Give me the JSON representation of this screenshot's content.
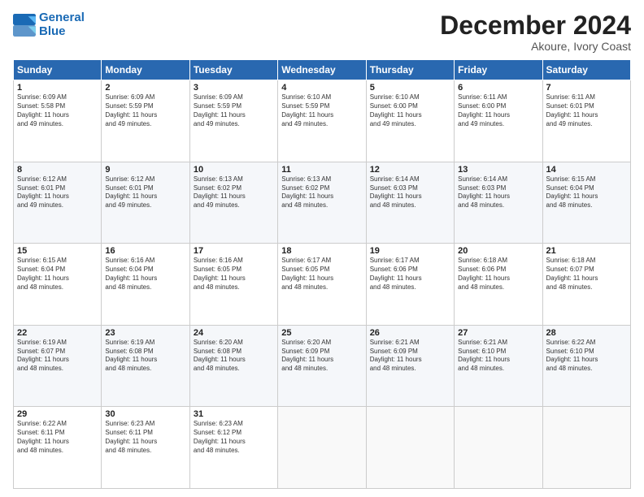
{
  "logo": {
    "line1": "General",
    "line2": "Blue"
  },
  "title": "December 2024",
  "location": "Akoure, Ivory Coast",
  "days_header": [
    "Sunday",
    "Monday",
    "Tuesday",
    "Wednesday",
    "Thursday",
    "Friday",
    "Saturday"
  ],
  "weeks": [
    [
      {
        "day": "1",
        "text": "Sunrise: 6:09 AM\nSunset: 5:58 PM\nDaylight: 11 hours\nand 49 minutes."
      },
      {
        "day": "2",
        "text": "Sunrise: 6:09 AM\nSunset: 5:59 PM\nDaylight: 11 hours\nand 49 minutes."
      },
      {
        "day": "3",
        "text": "Sunrise: 6:09 AM\nSunset: 5:59 PM\nDaylight: 11 hours\nand 49 minutes."
      },
      {
        "day": "4",
        "text": "Sunrise: 6:10 AM\nSunset: 5:59 PM\nDaylight: 11 hours\nand 49 minutes."
      },
      {
        "day": "5",
        "text": "Sunrise: 6:10 AM\nSunset: 6:00 PM\nDaylight: 11 hours\nand 49 minutes."
      },
      {
        "day": "6",
        "text": "Sunrise: 6:11 AM\nSunset: 6:00 PM\nDaylight: 11 hours\nand 49 minutes."
      },
      {
        "day": "7",
        "text": "Sunrise: 6:11 AM\nSunset: 6:01 PM\nDaylight: 11 hours\nand 49 minutes."
      }
    ],
    [
      {
        "day": "8",
        "text": "Sunrise: 6:12 AM\nSunset: 6:01 PM\nDaylight: 11 hours\nand 49 minutes."
      },
      {
        "day": "9",
        "text": "Sunrise: 6:12 AM\nSunset: 6:01 PM\nDaylight: 11 hours\nand 49 minutes."
      },
      {
        "day": "10",
        "text": "Sunrise: 6:13 AM\nSunset: 6:02 PM\nDaylight: 11 hours\nand 49 minutes."
      },
      {
        "day": "11",
        "text": "Sunrise: 6:13 AM\nSunset: 6:02 PM\nDaylight: 11 hours\nand 48 minutes."
      },
      {
        "day": "12",
        "text": "Sunrise: 6:14 AM\nSunset: 6:03 PM\nDaylight: 11 hours\nand 48 minutes."
      },
      {
        "day": "13",
        "text": "Sunrise: 6:14 AM\nSunset: 6:03 PM\nDaylight: 11 hours\nand 48 minutes."
      },
      {
        "day": "14",
        "text": "Sunrise: 6:15 AM\nSunset: 6:04 PM\nDaylight: 11 hours\nand 48 minutes."
      }
    ],
    [
      {
        "day": "15",
        "text": "Sunrise: 6:15 AM\nSunset: 6:04 PM\nDaylight: 11 hours\nand 48 minutes."
      },
      {
        "day": "16",
        "text": "Sunrise: 6:16 AM\nSunset: 6:04 PM\nDaylight: 11 hours\nand 48 minutes."
      },
      {
        "day": "17",
        "text": "Sunrise: 6:16 AM\nSunset: 6:05 PM\nDaylight: 11 hours\nand 48 minutes."
      },
      {
        "day": "18",
        "text": "Sunrise: 6:17 AM\nSunset: 6:05 PM\nDaylight: 11 hours\nand 48 minutes."
      },
      {
        "day": "19",
        "text": "Sunrise: 6:17 AM\nSunset: 6:06 PM\nDaylight: 11 hours\nand 48 minutes."
      },
      {
        "day": "20",
        "text": "Sunrise: 6:18 AM\nSunset: 6:06 PM\nDaylight: 11 hours\nand 48 minutes."
      },
      {
        "day": "21",
        "text": "Sunrise: 6:18 AM\nSunset: 6:07 PM\nDaylight: 11 hours\nand 48 minutes."
      }
    ],
    [
      {
        "day": "22",
        "text": "Sunrise: 6:19 AM\nSunset: 6:07 PM\nDaylight: 11 hours\nand 48 minutes."
      },
      {
        "day": "23",
        "text": "Sunrise: 6:19 AM\nSunset: 6:08 PM\nDaylight: 11 hours\nand 48 minutes."
      },
      {
        "day": "24",
        "text": "Sunrise: 6:20 AM\nSunset: 6:08 PM\nDaylight: 11 hours\nand 48 minutes."
      },
      {
        "day": "25",
        "text": "Sunrise: 6:20 AM\nSunset: 6:09 PM\nDaylight: 11 hours\nand 48 minutes."
      },
      {
        "day": "26",
        "text": "Sunrise: 6:21 AM\nSunset: 6:09 PM\nDaylight: 11 hours\nand 48 minutes."
      },
      {
        "day": "27",
        "text": "Sunrise: 6:21 AM\nSunset: 6:10 PM\nDaylight: 11 hours\nand 48 minutes."
      },
      {
        "day": "28",
        "text": "Sunrise: 6:22 AM\nSunset: 6:10 PM\nDaylight: 11 hours\nand 48 minutes."
      }
    ],
    [
      {
        "day": "29",
        "text": "Sunrise: 6:22 AM\nSunset: 6:11 PM\nDaylight: 11 hours\nand 48 minutes."
      },
      {
        "day": "30",
        "text": "Sunrise: 6:23 AM\nSunset: 6:11 PM\nDaylight: 11 hours\nand 48 minutes."
      },
      {
        "day": "31",
        "text": "Sunrise: 6:23 AM\nSunset: 6:12 PM\nDaylight: 11 hours\nand 48 minutes."
      },
      {
        "day": "",
        "text": ""
      },
      {
        "day": "",
        "text": ""
      },
      {
        "day": "",
        "text": ""
      },
      {
        "day": "",
        "text": ""
      }
    ]
  ]
}
